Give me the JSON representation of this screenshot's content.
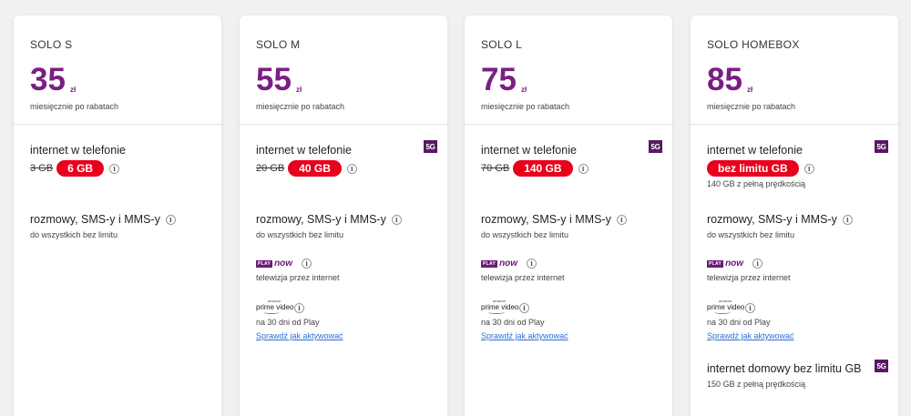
{
  "colors": {
    "brand": "#7b1e84",
    "pill": "#e8001c",
    "badge": "#5a1866",
    "link": "#2f6fd0"
  },
  "icons": {
    "info": "info-icon",
    "fiveg": "5g-badge"
  },
  "common": {
    "internet_title": "internet w telefonie",
    "calls_title": "rozmowy, SMS-y i MMS-y",
    "calls_sub": "do wszystkich bez limitu",
    "price_sub": "miesięcznie po rabatach",
    "currency": "zł",
    "info_glyph": "i",
    "fiveg": "5G",
    "playnow_play": "PLAY",
    "playnow_now": "now",
    "playnow_sub": "telewizja przez internet",
    "prime_top": "amazon",
    "prime_main": "prime video",
    "prime_sub": "na 30 dni od Play",
    "prime_link": "Sprawdź jak aktywować"
  },
  "plans": [
    {
      "name": "SOLO S",
      "price": "35",
      "old_data": "3 GB",
      "data": "6 GB"
    },
    {
      "name": "SOLO M",
      "price": "55",
      "old_data": "20 GB",
      "data": "40 GB"
    },
    {
      "name": "SOLO L",
      "price": "75",
      "old_data": "70 GB",
      "data": "140 GB"
    },
    {
      "name": "SOLO HOMEBOX",
      "price": "85",
      "data": "bez limitu GB",
      "data_sub": "140 GB z pełną prędkością",
      "home_title": "internet domowy bez limitu GB",
      "home_sub": "150 GB z pełną prędkością"
    }
  ]
}
